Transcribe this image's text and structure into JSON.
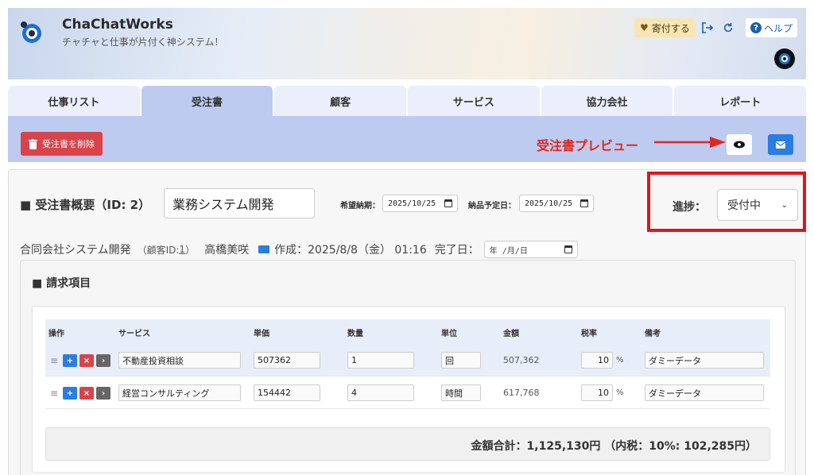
{
  "app": {
    "title": "ChaChatWorks",
    "subtitle": "チャチャと仕事が片付く神システム！",
    "donate_label": "寄付する",
    "help_label": "ヘルプ"
  },
  "tabs": [
    {
      "label": "仕事リスト",
      "active": false
    },
    {
      "label": "受注書",
      "active": true
    },
    {
      "label": "顧客",
      "active": false
    },
    {
      "label": "サービス",
      "active": false
    },
    {
      "label": "協力会社",
      "active": false
    },
    {
      "label": "レポート",
      "active": false
    }
  ],
  "action_bar": {
    "delete_label": "受注書を削除",
    "preview_annotation": "受注書プレビュー"
  },
  "summary": {
    "heading": "受注書概要（ID: 2）",
    "title_value": "業務システム開発",
    "desired_date_label": "希望納期：",
    "desired_date_value": "2025/10/25",
    "planned_date_label": "納品予定日：",
    "planned_date_value": "2025/10/25",
    "status_label": "進捗：",
    "status_value": "受付中"
  },
  "info": {
    "company": "合同会社システム開発",
    "customer_id_prefix": "（顧客ID: ",
    "customer_id": "1",
    "customer_id_suffix": "）",
    "person": "高橋美咲",
    "created": "作成：2025/8/8（金） 01:16",
    "done_label": "完了日：",
    "done_placeholder": "年 /月/日"
  },
  "items": {
    "heading": "請求項目",
    "columns": [
      "操作",
      "サービス",
      "単価",
      "数量",
      "単位",
      "金額",
      "税率",
      "備考"
    ],
    "rows": [
      {
        "service": "不動産投資相談",
        "price": "507362",
        "qty": "1",
        "unit": "回",
        "amount": "507,362",
        "tax": "10",
        "note": "ダミーデータ"
      },
      {
        "service": "経営コンサルティング",
        "price": "154442",
        "qty": "4",
        "unit": "時間",
        "amount": "617,768",
        "tax": "10",
        "note": "ダミーデータ"
      }
    ],
    "percent": "%",
    "total": "金額合計：1,125,130円 （内税：10%: 102,285円）"
  },
  "colors": {
    "accent_blue": "#2a7de1",
    "danger_red": "#d9434a",
    "annotation_red": "#e2271f",
    "tab_active": "#bccbef"
  }
}
